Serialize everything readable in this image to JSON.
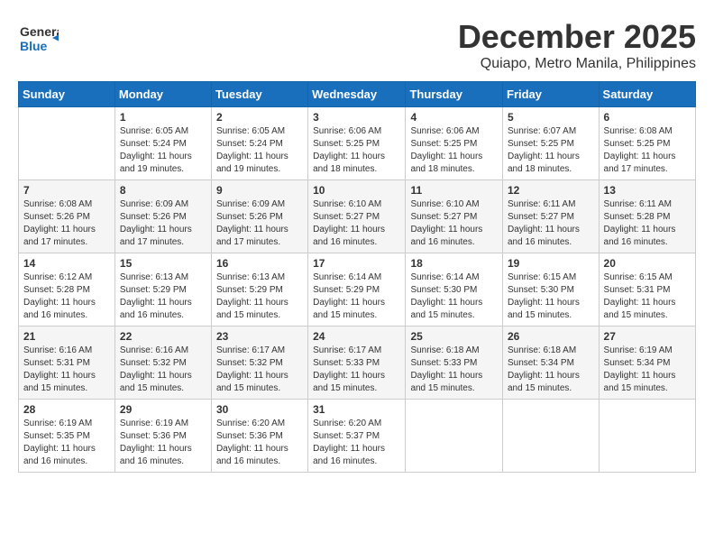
{
  "header": {
    "logo": {
      "line1": "General",
      "line2": "Blue"
    },
    "title": "December 2025",
    "location": "Quiapo, Metro Manila, Philippines"
  },
  "calendar": {
    "days_of_week": [
      "Sunday",
      "Monday",
      "Tuesday",
      "Wednesday",
      "Thursday",
      "Friday",
      "Saturday"
    ],
    "weeks": [
      [
        {
          "date": "",
          "sunrise": "",
          "sunset": "",
          "daylight": ""
        },
        {
          "date": "1",
          "sunrise": "6:05 AM",
          "sunset": "5:24 PM",
          "daylight": "11 hours and 19 minutes."
        },
        {
          "date": "2",
          "sunrise": "6:05 AM",
          "sunset": "5:24 PM",
          "daylight": "11 hours and 19 minutes."
        },
        {
          "date": "3",
          "sunrise": "6:06 AM",
          "sunset": "5:25 PM",
          "daylight": "11 hours and 18 minutes."
        },
        {
          "date": "4",
          "sunrise": "6:06 AM",
          "sunset": "5:25 PM",
          "daylight": "11 hours and 18 minutes."
        },
        {
          "date": "5",
          "sunrise": "6:07 AM",
          "sunset": "5:25 PM",
          "daylight": "11 hours and 18 minutes."
        },
        {
          "date": "6",
          "sunrise": "6:08 AM",
          "sunset": "5:25 PM",
          "daylight": "11 hours and 17 minutes."
        }
      ],
      [
        {
          "date": "7",
          "sunrise": "6:08 AM",
          "sunset": "5:26 PM",
          "daylight": "11 hours and 17 minutes."
        },
        {
          "date": "8",
          "sunrise": "6:09 AM",
          "sunset": "5:26 PM",
          "daylight": "11 hours and 17 minutes."
        },
        {
          "date": "9",
          "sunrise": "6:09 AM",
          "sunset": "5:26 PM",
          "daylight": "11 hours and 17 minutes."
        },
        {
          "date": "10",
          "sunrise": "6:10 AM",
          "sunset": "5:27 PM",
          "daylight": "11 hours and 16 minutes."
        },
        {
          "date": "11",
          "sunrise": "6:10 AM",
          "sunset": "5:27 PM",
          "daylight": "11 hours and 16 minutes."
        },
        {
          "date": "12",
          "sunrise": "6:11 AM",
          "sunset": "5:27 PM",
          "daylight": "11 hours and 16 minutes."
        },
        {
          "date": "13",
          "sunrise": "6:11 AM",
          "sunset": "5:28 PM",
          "daylight": "11 hours and 16 minutes."
        }
      ],
      [
        {
          "date": "14",
          "sunrise": "6:12 AM",
          "sunset": "5:28 PM",
          "daylight": "11 hours and 16 minutes."
        },
        {
          "date": "15",
          "sunrise": "6:13 AM",
          "sunset": "5:29 PM",
          "daylight": "11 hours and 16 minutes."
        },
        {
          "date": "16",
          "sunrise": "6:13 AM",
          "sunset": "5:29 PM",
          "daylight": "11 hours and 15 minutes."
        },
        {
          "date": "17",
          "sunrise": "6:14 AM",
          "sunset": "5:29 PM",
          "daylight": "11 hours and 15 minutes."
        },
        {
          "date": "18",
          "sunrise": "6:14 AM",
          "sunset": "5:30 PM",
          "daylight": "11 hours and 15 minutes."
        },
        {
          "date": "19",
          "sunrise": "6:15 AM",
          "sunset": "5:30 PM",
          "daylight": "11 hours and 15 minutes."
        },
        {
          "date": "20",
          "sunrise": "6:15 AM",
          "sunset": "5:31 PM",
          "daylight": "11 hours and 15 minutes."
        }
      ],
      [
        {
          "date": "21",
          "sunrise": "6:16 AM",
          "sunset": "5:31 PM",
          "daylight": "11 hours and 15 minutes."
        },
        {
          "date": "22",
          "sunrise": "6:16 AM",
          "sunset": "5:32 PM",
          "daylight": "11 hours and 15 minutes."
        },
        {
          "date": "23",
          "sunrise": "6:17 AM",
          "sunset": "5:32 PM",
          "daylight": "11 hours and 15 minutes."
        },
        {
          "date": "24",
          "sunrise": "6:17 AM",
          "sunset": "5:33 PM",
          "daylight": "11 hours and 15 minutes."
        },
        {
          "date": "25",
          "sunrise": "6:18 AM",
          "sunset": "5:33 PM",
          "daylight": "11 hours and 15 minutes."
        },
        {
          "date": "26",
          "sunrise": "6:18 AM",
          "sunset": "5:34 PM",
          "daylight": "11 hours and 15 minutes."
        },
        {
          "date": "27",
          "sunrise": "6:19 AM",
          "sunset": "5:34 PM",
          "daylight": "11 hours and 15 minutes."
        }
      ],
      [
        {
          "date": "28",
          "sunrise": "6:19 AM",
          "sunset": "5:35 PM",
          "daylight": "11 hours and 16 minutes."
        },
        {
          "date": "29",
          "sunrise": "6:19 AM",
          "sunset": "5:36 PM",
          "daylight": "11 hours and 16 minutes."
        },
        {
          "date": "30",
          "sunrise": "6:20 AM",
          "sunset": "5:36 PM",
          "daylight": "11 hours and 16 minutes."
        },
        {
          "date": "31",
          "sunrise": "6:20 AM",
          "sunset": "5:37 PM",
          "daylight": "11 hours and 16 minutes."
        },
        {
          "date": "",
          "sunrise": "",
          "sunset": "",
          "daylight": ""
        },
        {
          "date": "",
          "sunrise": "",
          "sunset": "",
          "daylight": ""
        },
        {
          "date": "",
          "sunrise": "",
          "sunset": "",
          "daylight": ""
        }
      ]
    ]
  }
}
